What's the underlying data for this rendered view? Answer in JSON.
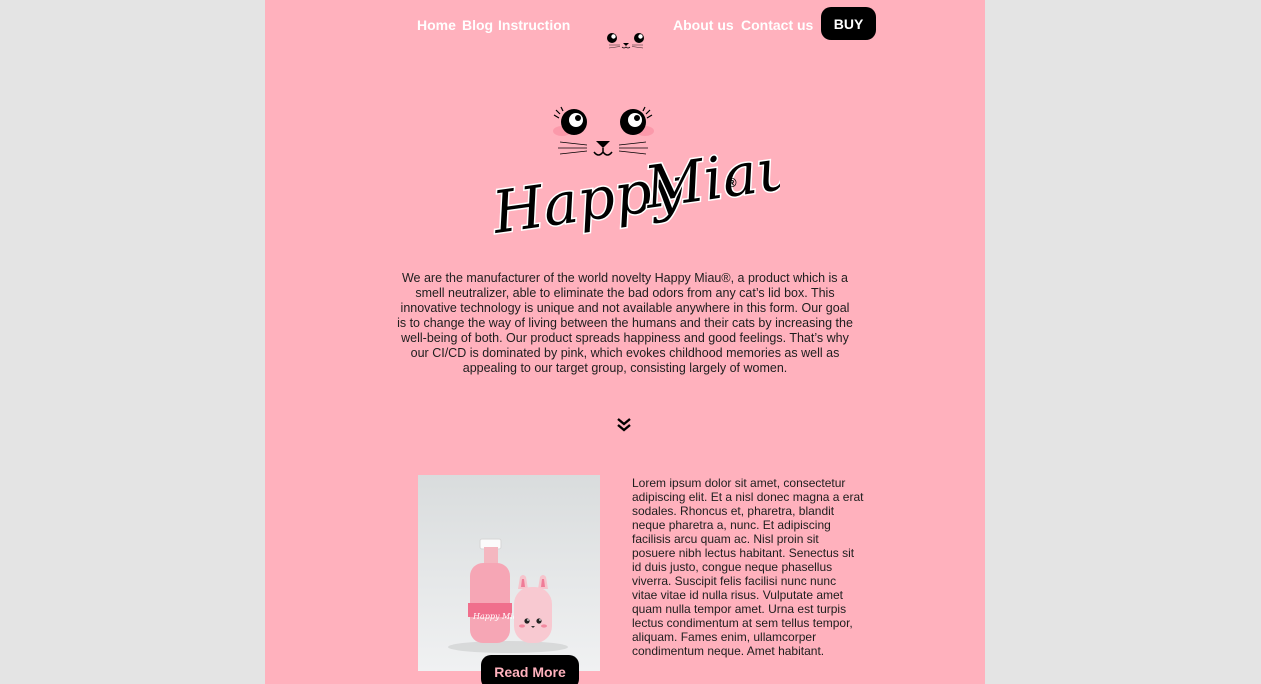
{
  "nav": {
    "home": "Home",
    "blog": "Blog",
    "instruction": "Instruction",
    "about": "About us",
    "contact": "Contact us",
    "buy": "BUY"
  },
  "brand": {
    "word1": "Happy",
    "word2": "Miau",
    "registered": "®"
  },
  "intro": {
    "text": "We are the manufacturer of the world novelty Happy Miau®, a product which is a smell neutralizer, able to eliminate the bad odors from any cat’s lid box. This innovative technology is unique and not available anywhere in this form. Our goal is to change the way of living between the humans and their cats by increasing the well-being of both. Our product spreads happiness and good feelings. That’s why our CI/CD is dominated by pink, which evokes childhood memories as well as appealing to our target group, consisting largely of women."
  },
  "product": {
    "description": "Lorem ipsum dolor sit amet, consectetur adipiscing elit. Et a nisl donec magna a erat sodales. Rhoncus et, pharetra, blandit neque pharetra a, nunc. Et adipiscing facilisis arcu quam ac. Nisl proin sit posuere nibh lectus habitant. Senectus sit id duis justo, congue neque phasellus viverra. Suscipit felis facilisi nunc nunc vitae vitae id nulla risus. Vulputate amet quam nulla tempor amet. Urna est turpis lectus condimentum at sem tellus tempor, aliquam. Fames enim, ullamcorper condimentum neque. Amet habitant.",
    "read_more": "Read More",
    "image_label": "Happy Miau"
  },
  "icons": {
    "logo_face": "cat-face-icon",
    "mini_face": "cat-face-icon",
    "scroll": "double-chevron-down-icon"
  },
  "colors": {
    "page_background": "#ffb1bd",
    "outer_background": "#e4e4e4",
    "button": "#000000",
    "nav_text": "#ffffff",
    "read_more_text": "#ffb1bd"
  }
}
